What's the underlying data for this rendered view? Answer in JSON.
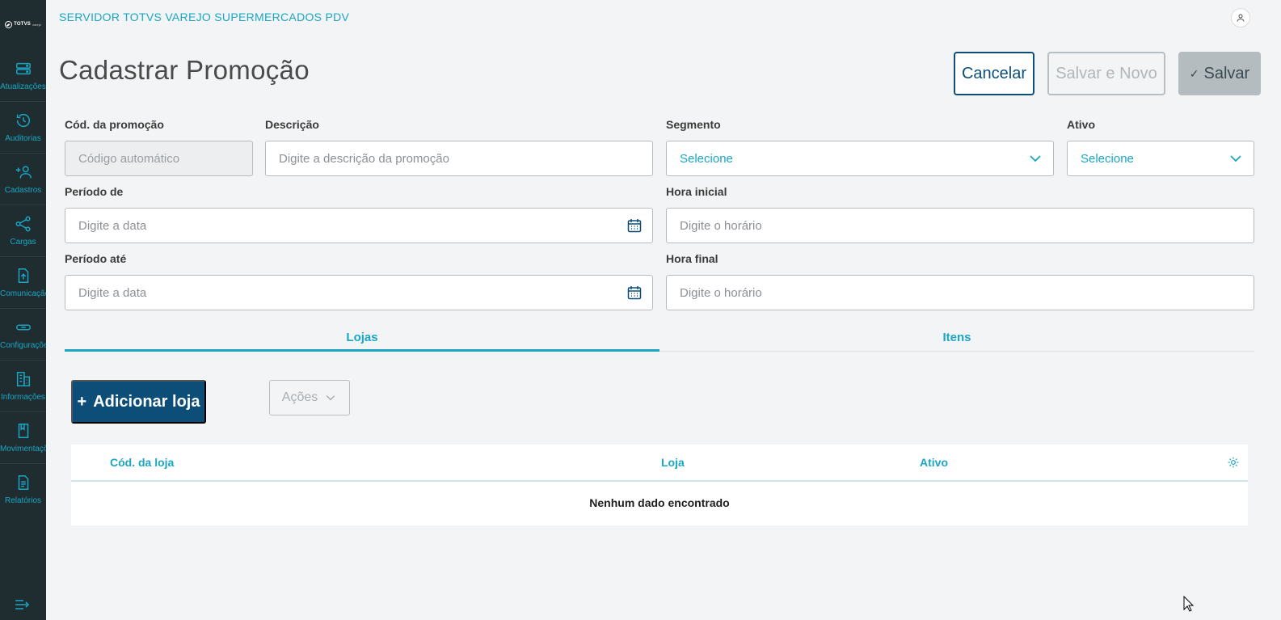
{
  "app": {
    "title": "SERVIDOR TOTVS VAREJO SUPERMERCADOS PDV",
    "logo_text": "TOTVS",
    "logo_sub": "varejo"
  },
  "sidebar": {
    "items": [
      {
        "label": "Atualizações",
        "icon": "server-icon"
      },
      {
        "label": "Auditorias",
        "icon": "history-icon"
      },
      {
        "label": "Cadastros",
        "icon": "add-user-icon"
      },
      {
        "label": "Cargas",
        "icon": "share-icon"
      },
      {
        "label": "Comunicação",
        "icon": "upload-file-icon"
      },
      {
        "label": "Configurações",
        "icon": "link-icon"
      },
      {
        "label": "Informações",
        "icon": "building-icon"
      },
      {
        "label": "Movimentações",
        "icon": "book-icon"
      },
      {
        "label": "Relatórios",
        "icon": "document-icon"
      }
    ]
  },
  "page": {
    "title": "Cadastrar Promoção"
  },
  "actions": {
    "cancel": "Cancelar",
    "save_new": "Salvar e Novo",
    "save": "Salvar"
  },
  "form": {
    "codigo": {
      "label": "Cód. da promoção",
      "placeholder": "Código automático"
    },
    "descricao": {
      "label": "Descrição",
      "placeholder": "Digite a descrição da promoção"
    },
    "segmento": {
      "label": "Segmento",
      "value": "Selecione"
    },
    "ativo": {
      "label": "Ativo",
      "value": "Selecione"
    },
    "periodo_de": {
      "label": "Período de",
      "placeholder": "Digite a data"
    },
    "hora_inicial": {
      "label": "Hora inicial",
      "placeholder": "Digite o horário"
    },
    "periodo_ate": {
      "label": "Período até",
      "placeholder": "Digite a data"
    },
    "hora_final": {
      "label": "Hora final",
      "placeholder": "Digite o horário"
    }
  },
  "tabs": [
    {
      "label": "Lojas",
      "active": true
    },
    {
      "label": "Itens",
      "active": false
    }
  ],
  "lojas": {
    "add_button": "Adicionar loja",
    "actions_button": "Ações",
    "columns": [
      "Cód. da loja",
      "Loja",
      "Ativo"
    ],
    "empty_message": "Nenhum dado encontrado"
  },
  "colors": {
    "accent": "#1aa6c4",
    "primary": "#0c4e78",
    "sidebar": "#1f2d30",
    "background": "#f2f4f5"
  }
}
